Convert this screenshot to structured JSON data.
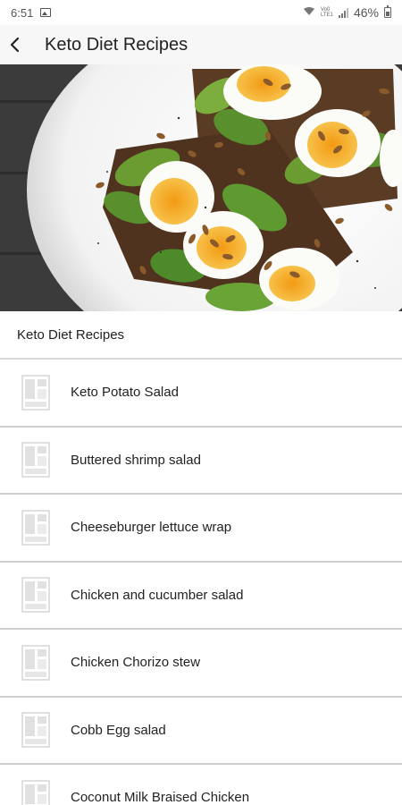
{
  "status_bar": {
    "time": "6:51",
    "battery_percent": "46%",
    "network_label": "Vo0 LTE1"
  },
  "app_bar": {
    "title": "Keto Diet Recipes",
    "back_icon": "chevron-left-icon"
  },
  "section": {
    "title": "Keto Diet Recipes"
  },
  "recipes": [
    {
      "name": "Keto Potato Salad",
      "icon": "image-placeholder-icon"
    },
    {
      "name": "Buttered shrimp salad",
      "icon": "image-placeholder-icon"
    },
    {
      "name": "Cheeseburger lettuce wrap",
      "icon": "image-placeholder-icon"
    },
    {
      "name": "Chicken and cucumber salad",
      "icon": "image-placeholder-icon"
    },
    {
      "name": "Chicken Chorizo stew",
      "icon": "image-placeholder-icon"
    },
    {
      "name": "Cobb Egg salad",
      "icon": "image-placeholder-icon"
    },
    {
      "name": "Coconut Milk Braised Chicken",
      "icon": "image-placeholder-icon"
    }
  ],
  "colors": {
    "app_bar_bg": "#f7f7f7",
    "divider": "#cfcfcf",
    "avocado": "#5a8f2e",
    "yolk": "#f4a31c"
  }
}
